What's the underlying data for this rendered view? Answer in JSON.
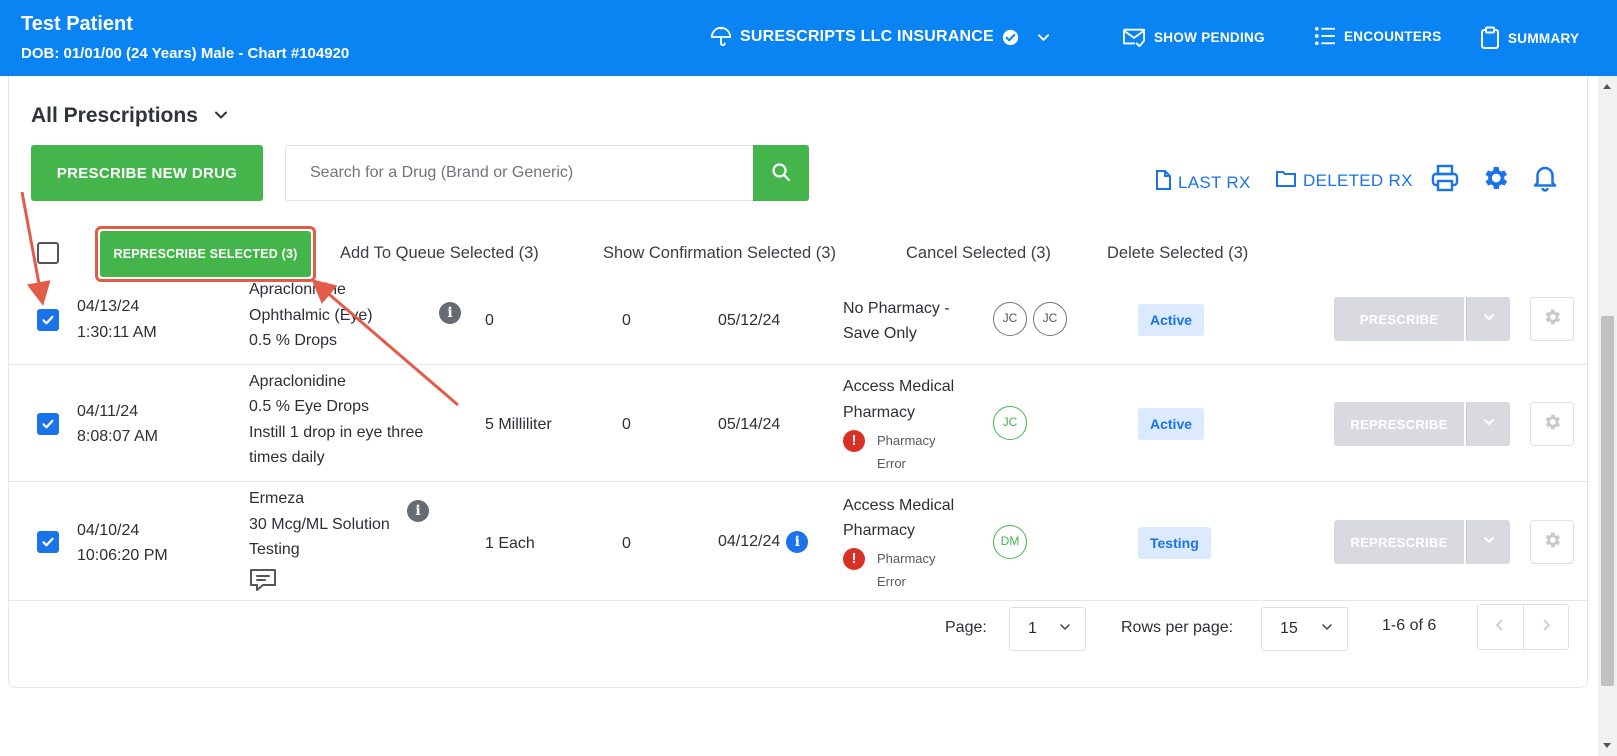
{
  "header": {
    "patient_name": "Test Patient",
    "patient_sub": "DOB: 01/01/00 (24 Years) Male - Chart #104920",
    "insurance": "SURESCRIPTS LLC INSURANCE",
    "show_pending": "SHOW PENDING",
    "encounters": "ENCOUNTERS",
    "summary": "SUMMARY"
  },
  "toolbar": {
    "filter_label": "All Prescriptions",
    "prescribe_new": "PRESCRIBE NEW DRUG",
    "search_placeholder": "Search for a Drug (Brand or Generic)",
    "last_rx": "LAST RX",
    "deleted_rx": "DELETED RX"
  },
  "bulk": {
    "represcribe": "REPRESCRIBE SELECTED (3)",
    "add_queue": "Add To Queue Selected (3)",
    "show_confirmation": "Show Confirmation Selected (3)",
    "cancel": "Cancel Selected (3)",
    "delete": "Delete Selected (3)"
  },
  "rows": [
    {
      "date": "04/13/24",
      "time": "1:30:11 AM",
      "drug_lines": [
        "Apraclonidine",
        "Ophthalmic (Eye)",
        "0.5 % Drops"
      ],
      "quantity": "0",
      "refills": "0",
      "end_date": "05/12/24",
      "pharmacy_lines": [
        "No Pharmacy -",
        "Save Only"
      ],
      "initials": [
        "JC",
        "JC"
      ],
      "status": "Active",
      "action": "PRESCRIBE"
    },
    {
      "date": "04/11/24",
      "time": "8:08:07 AM",
      "drug_lines": [
        "Apraclonidine",
        "0.5 % Eye Drops",
        "Instill 1 drop in eye three",
        "times daily"
      ],
      "quantity": "5 Milliliter",
      "refills": "0",
      "end_date": "05/14/24",
      "pharmacy_lines": [
        "Access Medical",
        "Pharmacy"
      ],
      "pharmacy_error": [
        "Pharmacy",
        "Error"
      ],
      "initials": [
        "JC"
      ],
      "status": "Active",
      "action": "REPRESCRIBE"
    },
    {
      "date": "04/10/24",
      "time": "10:06:20 PM",
      "drug_lines": [
        "Ermeza",
        "30 Mcg/ML Solution",
        "Testing"
      ],
      "quantity": "1 Each",
      "refills": "0",
      "end_date": "04/12/24",
      "pharmacy_lines": [
        "Access Medical",
        "Pharmacy"
      ],
      "pharmacy_error": [
        "Pharmacy",
        "Error"
      ],
      "initials": [
        "DM"
      ],
      "status": "Testing",
      "action": "REPRESCRIBE"
    }
  ],
  "pagination": {
    "page_label": "Page:",
    "page_value": "1",
    "rows_label": "Rows per page:",
    "rows_value": "15",
    "range": "1-6 of 6"
  },
  "colors": {
    "header_blue": "#0b84f3",
    "primary_green": "#43b54a",
    "link_blue": "#1a73e8",
    "annotation_red": "#e25c47",
    "error_red": "#d93025"
  }
}
